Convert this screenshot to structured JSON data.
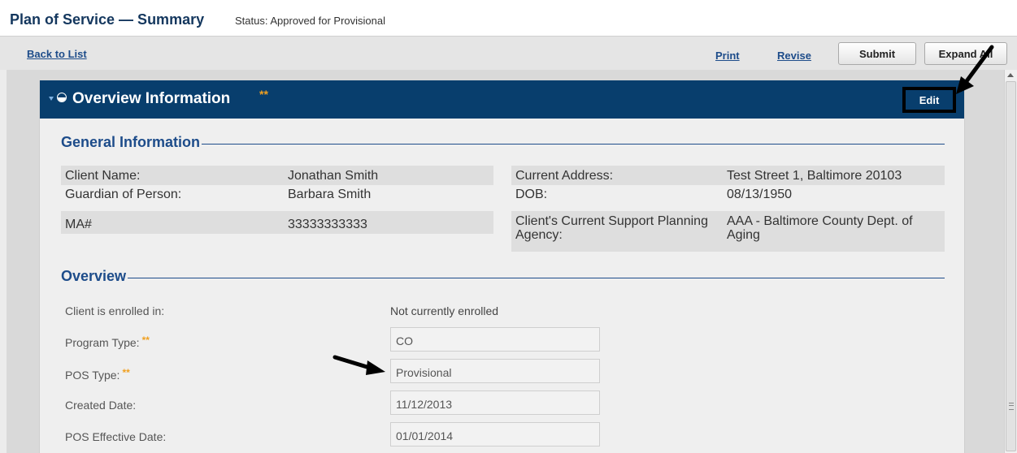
{
  "header": {
    "title": "Plan of Service — Summary",
    "status": "Status: Approved for Provisional"
  },
  "toolbar": {
    "back_label": "Back to List",
    "print_label": "Print",
    "revise_label": "Revise",
    "submit_label": "Submit",
    "expand_label": "Expand All"
  },
  "panel": {
    "title": "Overview Information",
    "required_mark": "**",
    "edit_label": "Edit"
  },
  "general": {
    "heading": "General Information",
    "left": [
      {
        "label": "Client Name:",
        "value": "Jonathan Smith"
      },
      {
        "label": "Guardian of Person:",
        "value": "Barbara Smith"
      },
      {
        "label": "MA#",
        "value": "33333333333"
      }
    ],
    "right": [
      {
        "label": "Current Address:",
        "value": "Test Street 1, Baltimore 20103"
      },
      {
        "label": "DOB:",
        "value": "08/13/1950"
      },
      {
        "label": "Client's Current Support Planning Agency:",
        "value": "AAA - Baltimore County Dept. of Aging"
      }
    ]
  },
  "overview": {
    "heading": "Overview",
    "enrolled_label": "Client is enrolled in:",
    "enrolled_value": "Not currently enrolled",
    "program_type_label": "Program Type:",
    "program_type_value": "CO",
    "pos_type_label": "POS Type:",
    "pos_type_value": "Provisional",
    "created_label": "Created Date:",
    "created_value": "11/12/2013",
    "effective_label": "POS Effective Date:",
    "effective_value": "01/01/2014"
  },
  "colors": {
    "panel_header": "#083e6d",
    "link": "#1d4c8a",
    "required_star": "#f0a020"
  }
}
